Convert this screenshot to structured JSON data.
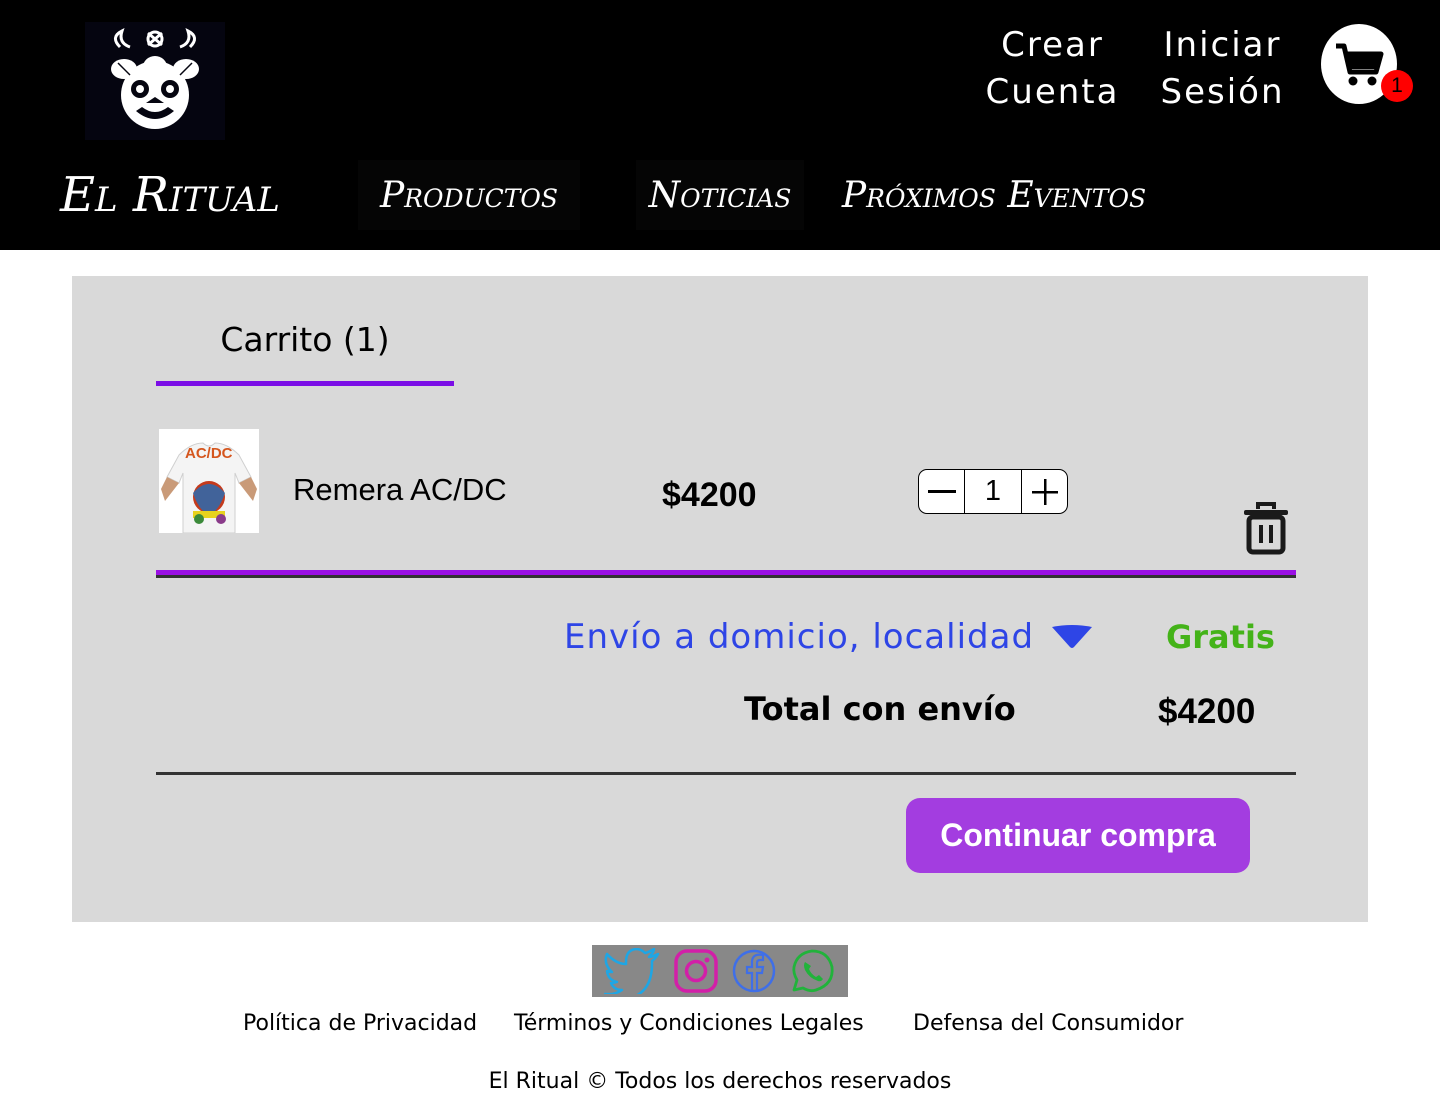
{
  "header": {
    "logo_icon": "demon-mask-logo",
    "create_account_line1": "Crear",
    "create_account_line2": "Cuenta",
    "login_line1": "Iniciar",
    "login_line2": "Sesión",
    "cart_icon": "shopping-cart-icon",
    "cart_count": "1"
  },
  "nav": {
    "brand": "El Ritual",
    "items": [
      {
        "label": "Productos"
      },
      {
        "label": "Noticias"
      },
      {
        "label": "Próximos Eventos"
      }
    ]
  },
  "cart": {
    "tab_label": "Carrito (1)",
    "item": {
      "name": "Remera AC/DC",
      "price": "$4200",
      "quantity": "1",
      "thumbnail_text": "AC/DC"
    },
    "shipping_label": "Envío a domicio, localidad",
    "shipping_price": "Gratis",
    "total_label": "Total con envío",
    "total_value": "$4200",
    "continue_label": "Continuar compra"
  },
  "footer": {
    "social": [
      "twitter-icon",
      "instagram-icon",
      "facebook-icon",
      "whatsapp-icon"
    ],
    "links": [
      "Política de Privacidad",
      "Términos y Condiciones Legales",
      "Defensa del Consumidor"
    ],
    "copyright": "El Ritual © Todos los derechos reservados"
  },
  "colors": {
    "accent_purple": "#9a10e4",
    "button_purple": "#a33de0",
    "shipping_blue": "#2e45e6",
    "free_green": "#44b319",
    "badge_red": "#ff0000"
  }
}
